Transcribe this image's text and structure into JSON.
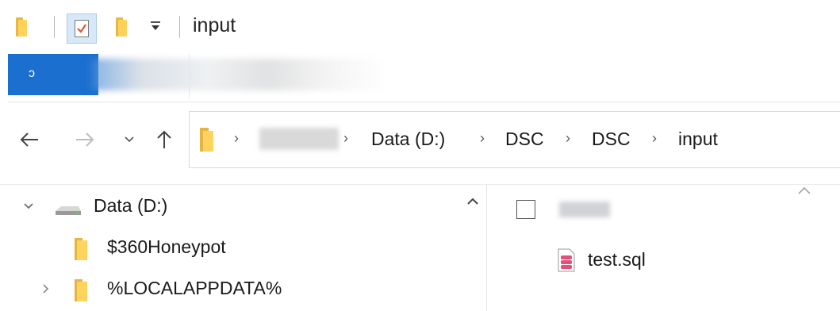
{
  "window": {
    "title": "input"
  },
  "ribbon": {
    "file_tab_label": "ɔ"
  },
  "address_bar": {
    "breadcrumbs": [
      "Data (D:)",
      "DSC",
      "DSC",
      "input"
    ]
  },
  "navigation_pane": {
    "items": [
      {
        "label": "Data (D:)",
        "icon": "drive-icon",
        "expanded": true
      },
      {
        "label": "$360Honeypot",
        "icon": "folder-icon"
      },
      {
        "label": "%LOCALAPPDATA%",
        "icon": "folder-icon",
        "expanded": false
      }
    ]
  },
  "file_list": {
    "items": [
      {
        "name": "test.sql",
        "icon": "sql-file-icon"
      }
    ]
  },
  "colors": {
    "file_tab": "#1a6fcf",
    "folder": "#ffd45c",
    "sql_icon": "#e0507a"
  }
}
